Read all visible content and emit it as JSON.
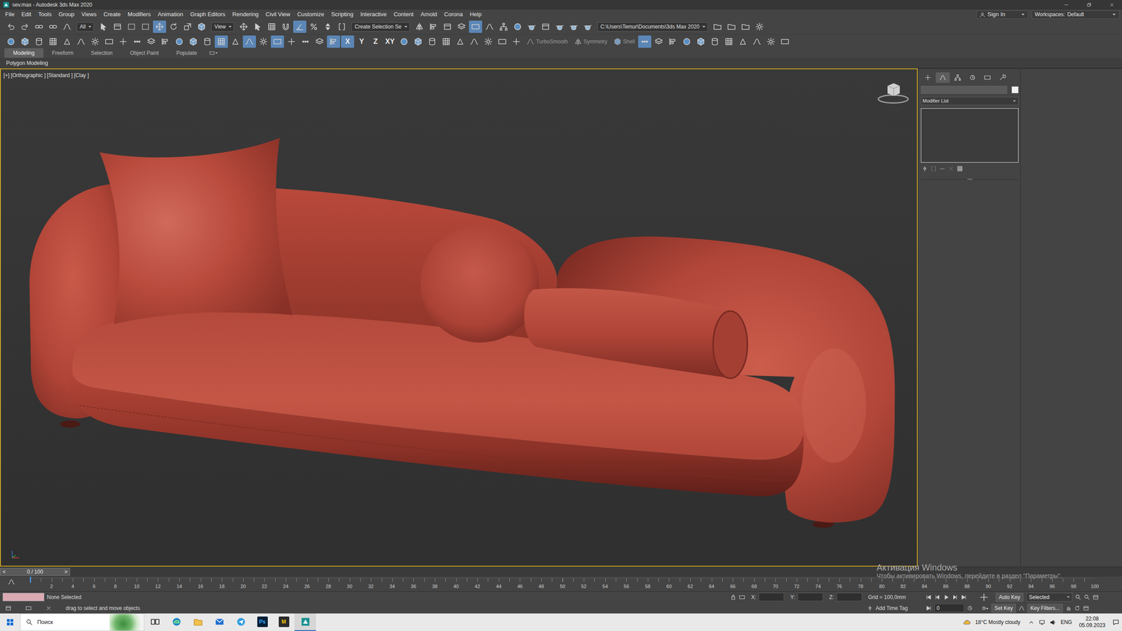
{
  "window": {
    "title": "sev.max - Autodesk 3ds Max 2020"
  },
  "menu": [
    "File",
    "Edit",
    "Tools",
    "Group",
    "Views",
    "Create",
    "Modifiers",
    "Animation",
    "Graph Editors",
    "Rendering",
    "Civil View",
    "Customize",
    "Scripting",
    "Interactive",
    "Content",
    "Arnold",
    "Corona",
    "Help"
  ],
  "account": {
    "label": "Sign In"
  },
  "workspaces": {
    "label": "Workspaces:",
    "value": "Default"
  },
  "main_toolbar": [
    {
      "kind": "button",
      "on": false
    },
    {
      "kind": "button",
      "on": false
    },
    {
      "kind": "button",
      "on": false
    },
    {
      "kind": "button",
      "on": false
    },
    {
      "kind": "button",
      "on": false
    },
    {
      "kind": "dropdown",
      "label": "All"
    },
    {
      "kind": "button",
      "on": false
    },
    {
      "kind": "button",
      "on": false
    },
    {
      "kind": "button",
      "on": false
    },
    {
      "kind": "button",
      "on": false
    },
    {
      "kind": "button",
      "on": true
    },
    {
      "kind": "button",
      "on": false
    },
    {
      "kind": "button",
      "on": false
    },
    {
      "kind": "button",
      "on": false
    },
    {
      "kind": "dropdown",
      "label": "View"
    },
    {
      "kind": "button",
      "on": false
    },
    {
      "kind": "button",
      "on": false
    },
    {
      "kind": "button",
      "on": false
    },
    {
      "kind": "button",
      "on": false
    },
    {
      "kind": "button",
      "on": true
    },
    {
      "kind": "button",
      "on": false
    },
    {
      "kind": "button",
      "on": false
    },
    {
      "kind": "button",
      "on": false
    },
    {
      "kind": "dropdown",
      "label": "Create Selection Se"
    },
    {
      "kind": "button",
      "on": false
    },
    {
      "kind": "button",
      "on": false
    },
    {
      "kind": "button",
      "on": false
    },
    {
      "kind": "button",
      "on": false
    },
    {
      "kind": "button",
      "on": true
    },
    {
      "kind": "button",
      "on": false
    },
    {
      "kind": "button",
      "on": false
    },
    {
      "kind": "button",
      "on": false
    },
    {
      "kind": "button",
      "on": false
    },
    {
      "kind": "button",
      "on": false
    },
    {
      "kind": "button",
      "on": false
    },
    {
      "kind": "button",
      "on": false
    },
    {
      "kind": "button",
      "on": false
    },
    {
      "kind": "field",
      "label": "C:\\Users\\Temur\\Documents\\3ds Max 2020"
    },
    {
      "kind": "button",
      "on": false
    },
    {
      "kind": "button",
      "on": false
    },
    {
      "kind": "button",
      "on": false
    },
    {
      "kind": "button",
      "on": false
    }
  ],
  "modeling_toolbar": [
    {
      "kind": "button",
      "on": false
    },
    {
      "kind": "button",
      "on": false
    },
    {
      "kind": "button",
      "on": false
    },
    {
      "kind": "button",
      "on": false
    },
    {
      "kind": "button",
      "on": false
    },
    {
      "kind": "button",
      "on": false
    },
    {
      "kind": "button",
      "on": false
    },
    {
      "kind": "button",
      "on": false
    },
    {
      "kind": "button",
      "on": false
    },
    {
      "kind": "button",
      "on": false
    },
    {
      "kind": "button",
      "on": false
    },
    {
      "kind": "button",
      "on": false
    },
    {
      "kind": "button",
      "on": false
    },
    {
      "kind": "button",
      "on": false
    },
    {
      "kind": "button",
      "on": false
    },
    {
      "kind": "button",
      "on": true
    },
    {
      "kind": "button",
      "on": false
    },
    {
      "kind": "button",
      "on": true
    },
    {
      "kind": "button",
      "on": false
    },
    {
      "kind": "button",
      "on": true
    },
    {
      "kind": "button",
      "on": false
    },
    {
      "kind": "button",
      "on": false
    },
    {
      "kind": "button",
      "on": false
    },
    {
      "kind": "button",
      "on": true
    },
    {
      "kind": "toggle",
      "label": "X",
      "on": true
    },
    {
      "kind": "toggle",
      "label": "Y",
      "on": false
    },
    {
      "kind": "toggle",
      "label": "Z",
      "on": false
    },
    {
      "kind": "toggle",
      "label": "XY",
      "on": false
    },
    {
      "kind": "button",
      "on": false
    },
    {
      "kind": "button",
      "on": false
    },
    {
      "kind": "button",
      "on": false
    },
    {
      "kind": "button",
      "on": false
    },
    {
      "kind": "button",
      "on": false
    },
    {
      "kind": "button",
      "on": false
    },
    {
      "kind": "button",
      "on": false
    },
    {
      "kind": "button",
      "on": false
    },
    {
      "kind": "button",
      "on": false
    },
    {
      "kind": "labeled",
      "label": "TurboSmooth",
      "disabled": true
    },
    {
      "kind": "labeled",
      "label": "Symmetry",
      "disabled": true
    },
    {
      "kind": "labeled",
      "label": "Shell",
      "disabled": true
    },
    {
      "kind": "button",
      "on": true
    },
    {
      "kind": "button",
      "on": false
    },
    {
      "kind": "button",
      "on": false
    },
    {
      "kind": "button",
      "on": false
    },
    {
      "kind": "button",
      "on": false
    },
    {
      "kind": "button",
      "on": false
    },
    {
      "kind": "button",
      "on": false
    },
    {
      "kind": "button",
      "on": false
    },
    {
      "kind": "button",
      "on": false
    },
    {
      "kind": "button",
      "on": false
    },
    {
      "kind": "button",
      "on": false
    }
  ],
  "ribbon": {
    "tabs": [
      {
        "label": "Modeling",
        "selected": true
      },
      {
        "label": "Freeform",
        "selected": false
      },
      {
        "label": "Selection",
        "selected": false
      },
      {
        "label": "Object Paint",
        "selected": false
      },
      {
        "label": "Populate",
        "selected": false
      }
    ],
    "panel": "Polygon Modeling"
  },
  "viewport": {
    "labels": [
      "[+]",
      "[Orthographic ]",
      "[Standard ]",
      "[Clay ]"
    ]
  },
  "command_panel": {
    "tabs": [
      {
        "selected": false
      },
      {
        "selected": true
      },
      {
        "selected": false
      },
      {
        "selected": false
      },
      {
        "selected": false
      },
      {
        "selected": false
      }
    ],
    "modifier_list": "Modifier List",
    "stack_tools": [
      {
        "disabled": false
      },
      {
        "disabled": true
      },
      {
        "disabled": true
      },
      {
        "disabled": true
      },
      {
        "disabled": false
      }
    ]
  },
  "time_slider": {
    "prev": "<",
    "label": "0 / 100",
    "next": ">",
    "level": 0
  },
  "track_bar": {
    "ticks": [
      "2",
      "4",
      "6",
      "8",
      "10",
      "12",
      "14",
      "16",
      "18",
      "20",
      "22",
      "24",
      "26",
      "28",
      "30",
      "32",
      "34",
      "36",
      "38",
      "40",
      "42",
      "44",
      "46",
      "48",
      "50",
      "52",
      "54",
      "56",
      "58",
      "60",
      "62",
      "64",
      "66",
      "68",
      "70",
      "72",
      "74",
      "76",
      "78",
      "80",
      "82",
      "84",
      "86",
      "88",
      "90",
      "92",
      "94",
      "96",
      "98",
      "100"
    ]
  },
  "status_bar": {
    "selection": "None Selected",
    "prompt": "drag to select and move objects",
    "coords": [
      {
        "label": "X:"
      },
      {
        "label": "Y:"
      },
      {
        "label": "Z:"
      }
    ],
    "grid": "Grid = 100,0mm",
    "time_tag": "Add Time Tag",
    "auto_key": "Auto Key",
    "key_mode": "Selected",
    "set_key": "Set Key",
    "key_filters": "Key Filters...",
    "frame": "0"
  },
  "watermark": {
    "title": "Активация Windows",
    "text": "Чтобы активировать Windows, перейдите в раздел \"Параметры\"."
  },
  "taskbar": {
    "search": "Поиск",
    "apps": [
      {
        "kind": "task-view",
        "selected": false
      },
      {
        "kind": "edge",
        "selected": false
      },
      {
        "kind": "explorer",
        "selected": false
      },
      {
        "kind": "mail",
        "selected": false
      },
      {
        "kind": "browser",
        "selected": false
      },
      {
        "kind": "photoshop",
        "label": "Ps",
        "selected": false
      },
      {
        "kind": "lettered",
        "label": "M",
        "selected": false
      },
      {
        "kind": "max",
        "selected": true
      }
    ],
    "weather": "18°C Mostly cloudy",
    "language": "ENG",
    "time": "22:08",
    "date": "05.09.2023"
  }
}
